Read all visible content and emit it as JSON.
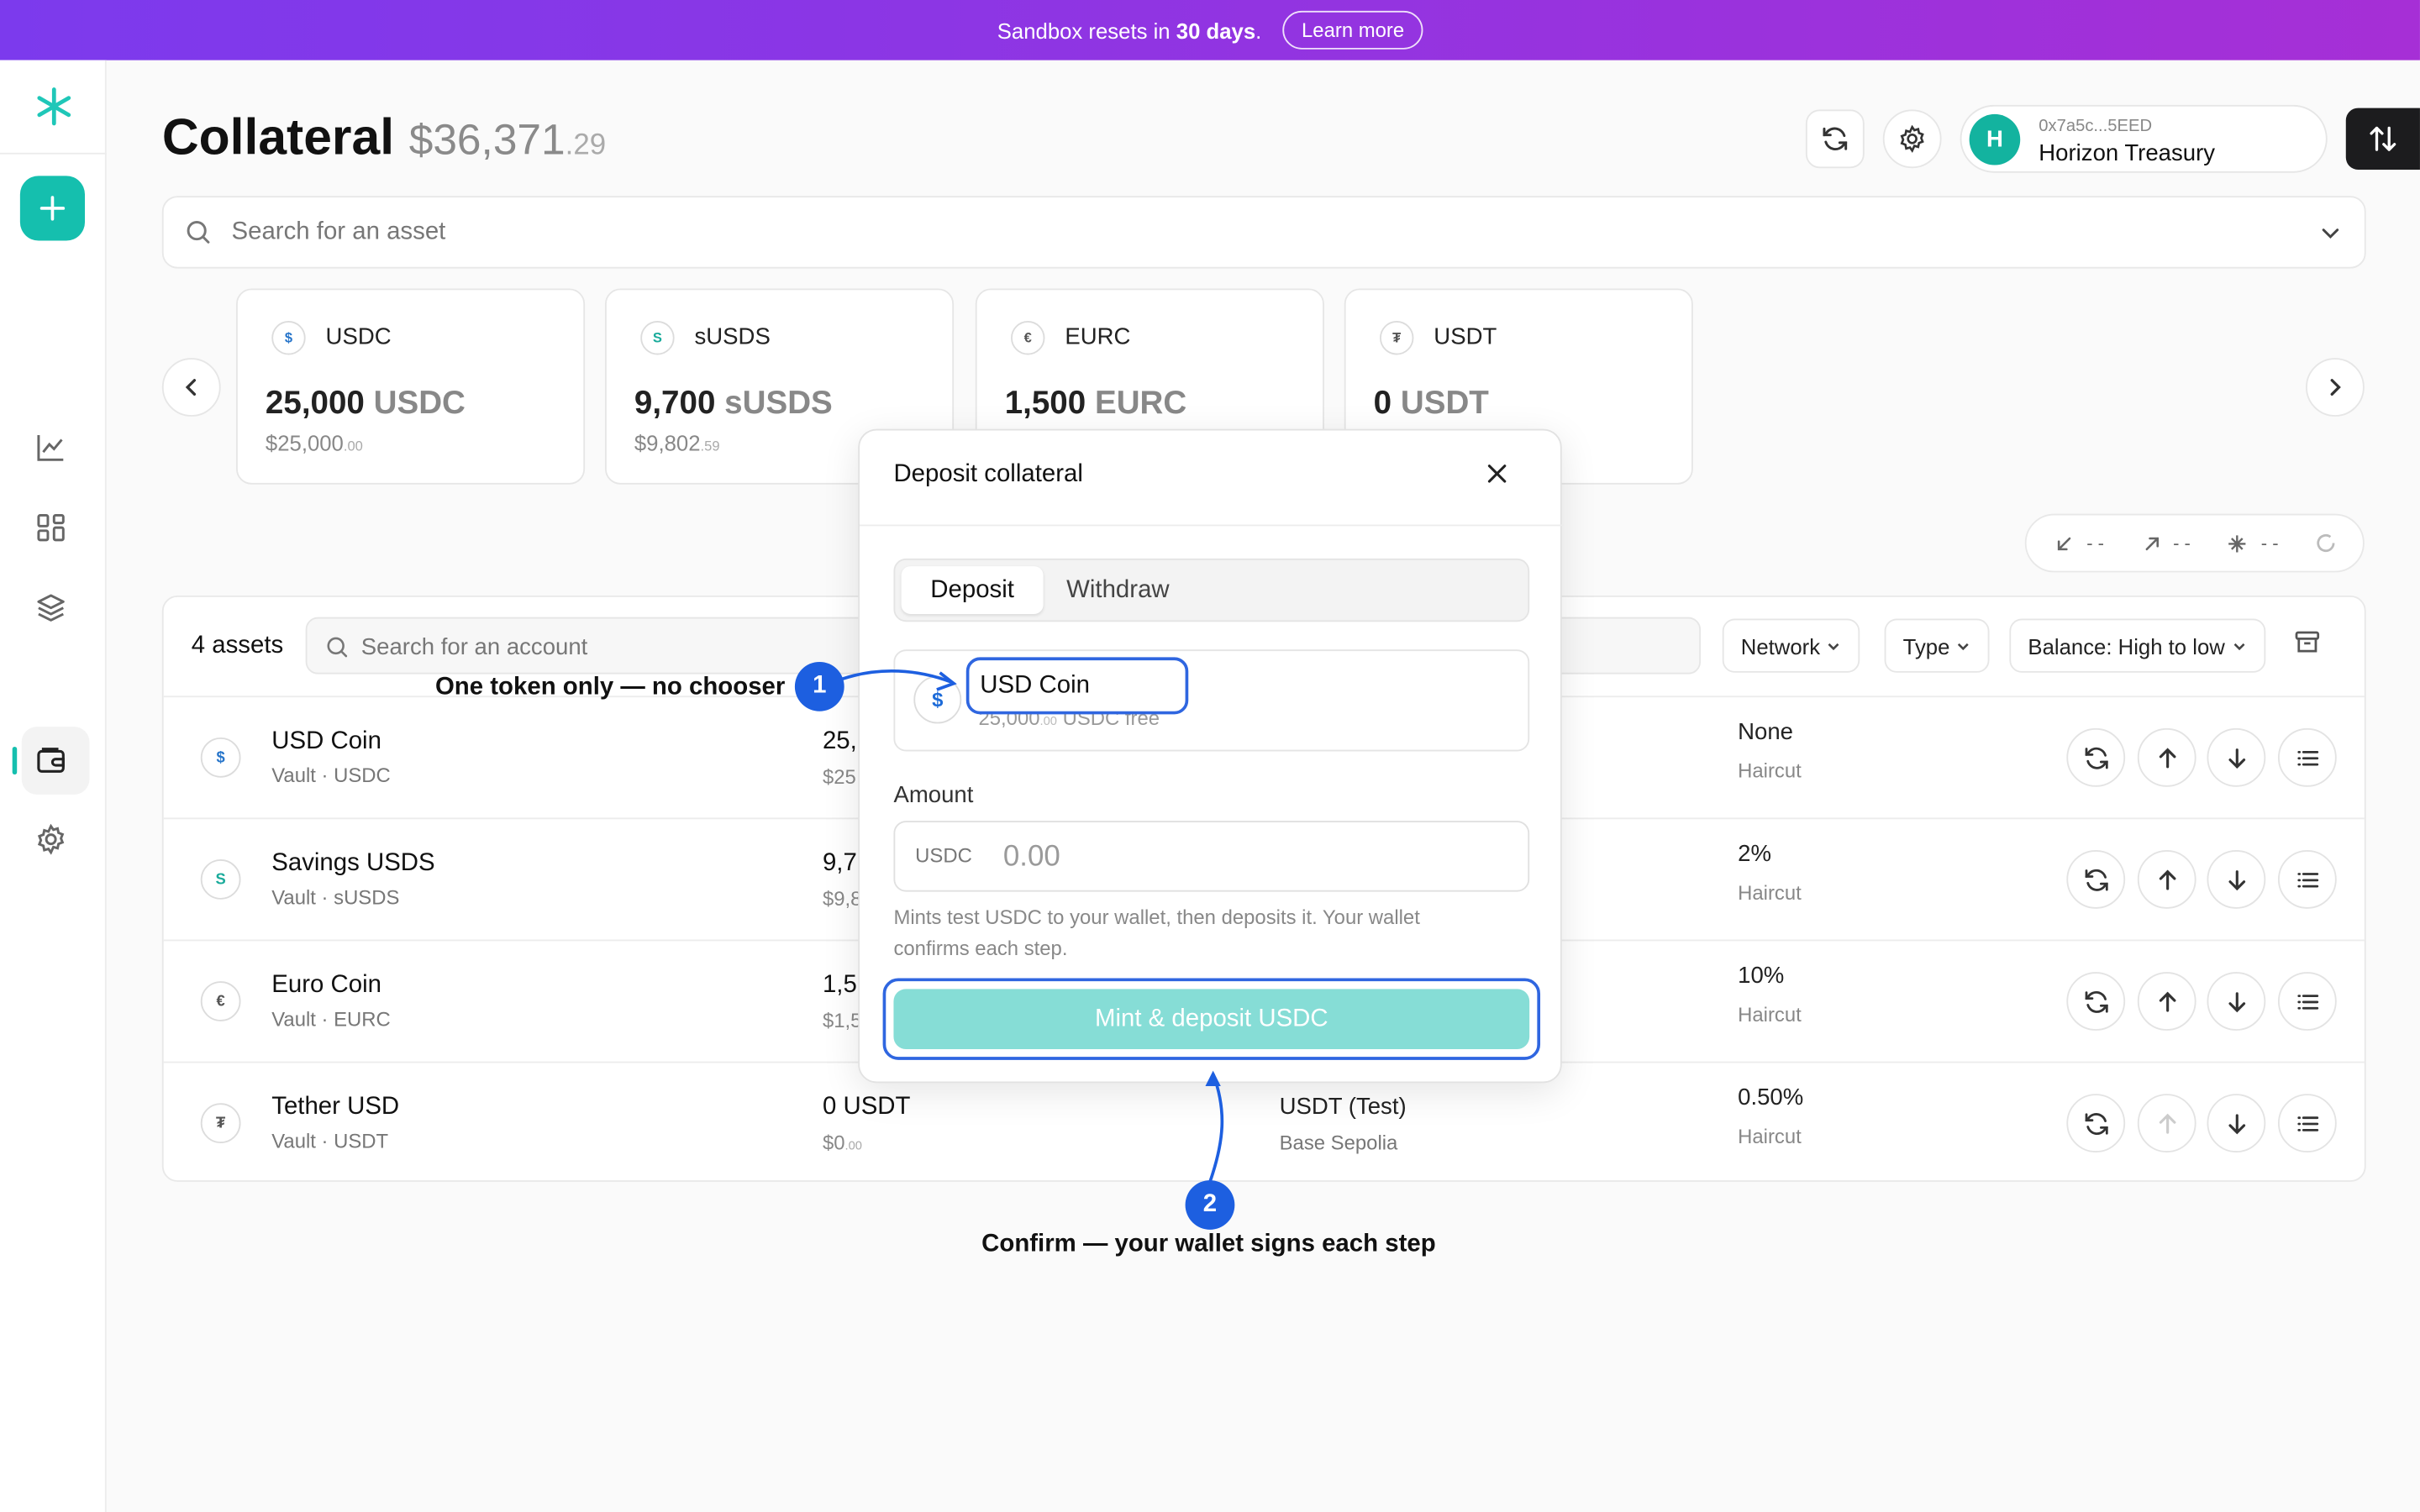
{
  "banner": {
    "text_prefix": "Sandbox resets in ",
    "days": "30 days",
    "text_suffix": ".",
    "learn_more": "Learn more"
  },
  "sidebar": {
    "logo": "logo-asterisk",
    "add_label": "+",
    "items": [
      "chart-icon",
      "grid-icon",
      "layers-icon",
      "wallet-icon",
      "settings-icon"
    ],
    "active": "wallet-icon"
  },
  "header": {
    "title": "Collateral",
    "total_main": "$36,371",
    "total_cents": ".29"
  },
  "wallet": {
    "initial": "H",
    "address": "0x7a5c...5EED",
    "name": "Horizon Treasury"
  },
  "search": {
    "placeholder": "Search for an asset"
  },
  "cards": [
    {
      "icon": "$",
      "symbol": "USDC",
      "amount": "25,000",
      "unit": "USDC",
      "usd": "$25,000",
      "usd_cents": ".00",
      "color": "#2775ca"
    },
    {
      "icon": "S",
      "symbol": "sUSDS",
      "amount": "9,700",
      "unit": "sUSDS",
      "usd": "$9,802",
      "usd_cents": ".59",
      "color": "#1aab9b"
    },
    {
      "icon": "€",
      "symbol": "EURC",
      "amount": "1,500",
      "unit": "EURC",
      "usd": "",
      "usd_cents": "",
      "color": "#555555"
    },
    {
      "icon": "₮",
      "symbol": "USDT",
      "amount": "0",
      "unit": "USDT",
      "usd": "",
      "usd_cents": "",
      "color": "#555555"
    }
  ],
  "stats": {
    "in": "- -",
    "out": "- -",
    "yield": "- -"
  },
  "table": {
    "count": "4 assets",
    "account_placeholder": "Search for an account",
    "filters": {
      "network": "Network",
      "type": "Type",
      "sort": "Balance: High to low"
    },
    "rows": [
      {
        "icon": "$",
        "name": "USD Coin",
        "sub": "Vault · USDC",
        "balance": "25,",
        "usd": "$25",
        "usd_cents": "",
        "network": "",
        "network_sub": "",
        "haircut": "None",
        "haircut_label": "Haircut",
        "color": "#2775ca"
      },
      {
        "icon": "S",
        "name": "Savings USDS",
        "sub": "Vault · sUSDS",
        "balance": "9,7",
        "usd": "$9,8",
        "usd_cents": "",
        "network": "",
        "network_sub": "",
        "haircut": "2%",
        "haircut_label": "Haircut",
        "color": "#1aab9b"
      },
      {
        "icon": "€",
        "name": "Euro Coin",
        "sub": "Vault · EURC",
        "balance": "1,5",
        "usd": "$1,5",
        "usd_cents": "",
        "network": "",
        "network_sub": "",
        "haircut": "10%",
        "haircut_label": "Haircut",
        "color": "#555555"
      },
      {
        "icon": "₮",
        "name": "Tether USD",
        "sub": "Vault · USDT",
        "balance": "0 USDT",
        "usd": "$0",
        "usd_cents": ".00",
        "network": "USDT (Test)",
        "network_sub": "Base Sepolia",
        "haircut": "0.50%",
        "haircut_label": "Haircut",
        "color": "#555555"
      }
    ]
  },
  "modal": {
    "title": "Deposit collateral",
    "tab_deposit": "Deposit",
    "tab_withdraw": "Withdraw",
    "token_icon": "$",
    "token_name": "USD Coin",
    "token_free": "25,000",
    "token_free_cents": ".00",
    "token_free_suffix": " USDC free",
    "amount_label": "Amount",
    "amount_unit": "USDC",
    "amount_placeholder": "0.00",
    "help": "Mints test USDC to your wallet, then deposits it. Your wallet confirms each step.",
    "cta": "Mint & deposit USDC"
  },
  "annotations": [
    {
      "number": "1",
      "text": "One token only — no chooser"
    },
    {
      "number": "2",
      "text": "Confirm — your wallet signs each step"
    }
  ],
  "colors": {
    "accent": "#15bfae",
    "annotation": "#1d5fe0",
    "banner_start": "#7c3aed",
    "banner_end": "#a62fd6"
  }
}
